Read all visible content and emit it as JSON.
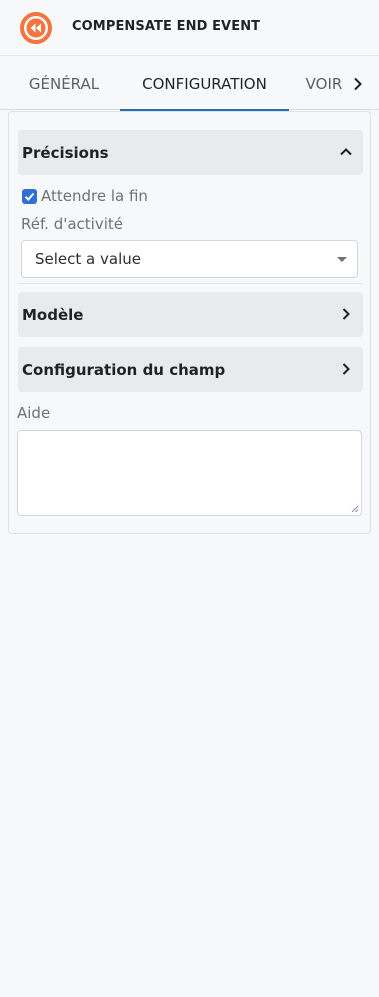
{
  "header": {
    "title": "COMPENSATE END EVENT",
    "icon": "compensate-end-event-icon",
    "icon_color": "#f2743f"
  },
  "tabs": [
    {
      "label": "GÉNÉRAL",
      "active": false
    },
    {
      "label": "CONFIGURATION",
      "active": true
    },
    {
      "label": "VOIR",
      "active": false
    }
  ],
  "tabs_next_icon": "chevron-right-icon",
  "sections": {
    "precisions": {
      "label": "Précisions",
      "expanded": true,
      "wait_checkbox": {
        "label": "Attendre la fin",
        "checked": true
      },
      "activity_ref": {
        "label": "Réf. d'activité",
        "value": "Select a value"
      }
    },
    "modele": {
      "label": "Modèle",
      "expanded": false
    },
    "field_config": {
      "label": "Configuration du champ",
      "expanded": false
    }
  },
  "aide": {
    "label": "Aide",
    "value": ""
  },
  "colors": {
    "accent": "#2f6fd6",
    "tab_underline": "#2b6cb0",
    "section_header_bg": "#e8eaed",
    "page_bg": "#f7f8fa"
  }
}
